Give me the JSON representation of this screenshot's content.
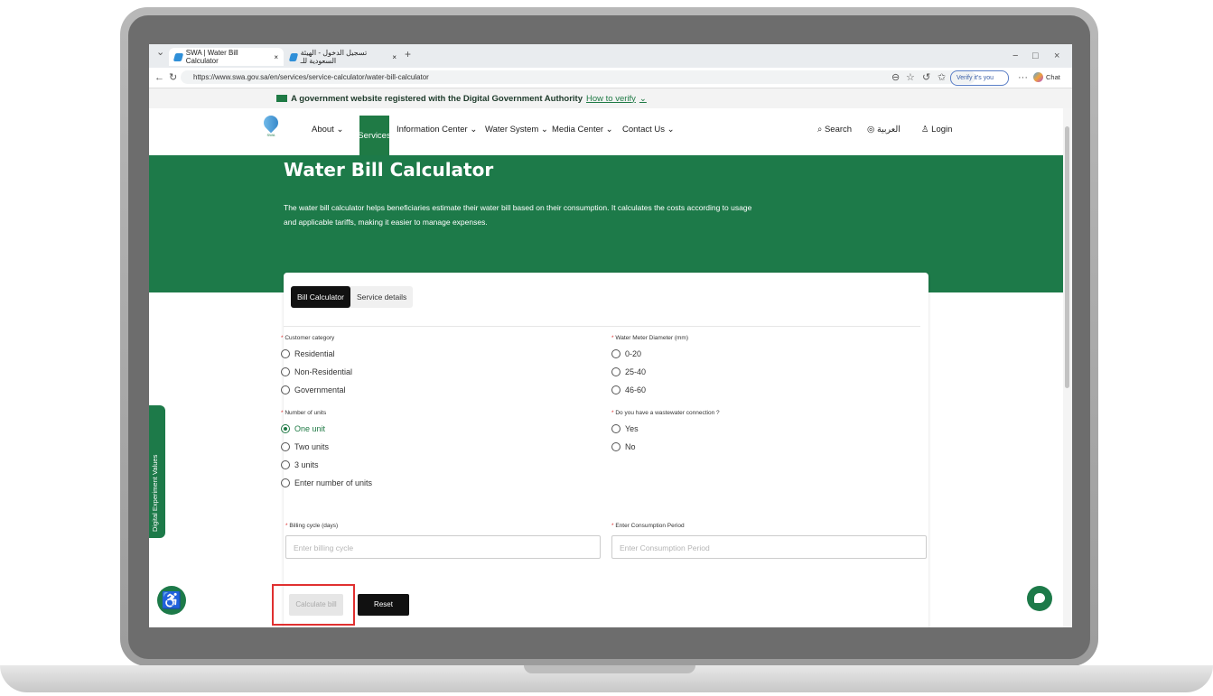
{
  "browser": {
    "tabs": [
      {
        "label": "SWA | Water Bill Calculator",
        "close": "×"
      },
      {
        "label": "تسجيل الدخول - الهيئة السعودية للـ",
        "close": "×"
      }
    ],
    "new_tab": "+",
    "url": "https://www.swa.gov.sa/en/services/service-calculator/water-bill-calculator",
    "verify_label": "Verify it's you",
    "chat_label": "Chat",
    "window_controls": [
      "−",
      "□",
      "×"
    ]
  },
  "govbar": {
    "text": "A government website registered with the Digital Government Authority",
    "link": "How to verify"
  },
  "nav": {
    "items": [
      "About",
      "Services",
      "Information Center",
      "Water System",
      "Media Center",
      "Contact Us"
    ],
    "search": "Search",
    "lang": "العربية",
    "login": "Login"
  },
  "hero": {
    "title": "Water Bill Calculator",
    "description": "The water bill calculator helps beneficiaries estimate their water bill based on their consumption. It calculates the costs according to usage and applicable tariffs, making it easier to manage expenses."
  },
  "form": {
    "tabs": [
      "Bill Calculator",
      "Service details"
    ],
    "customer_category": {
      "label": "Customer category",
      "options": [
        "Residential",
        "Non-Residential",
        "Governmental"
      ]
    },
    "meter_diameter": {
      "label": "Water Meter Diameter (mm)",
      "options": [
        "0-20",
        "25-40",
        "46-60"
      ]
    },
    "units": {
      "label": "Number of units",
      "options": [
        "One unit",
        "Two units",
        "3 units",
        "Enter number of units"
      ],
      "selected": "One unit"
    },
    "wastewater": {
      "label": "Do you have a wastewater connection ?",
      "options": [
        "Yes",
        "No"
      ]
    },
    "billing_cycle": {
      "label": "Billing cycle (days)",
      "placeholder": "Enter billing cycle"
    },
    "consumption": {
      "label": "Enter Consumption Period",
      "placeholder": "Enter Consumption Period"
    },
    "calculate": "Calculate bill",
    "reset": "Reset"
  },
  "side_tab": "Digital Experiment Values",
  "colors": {
    "brand": "#1d7a49",
    "highlight": "#e03030"
  }
}
